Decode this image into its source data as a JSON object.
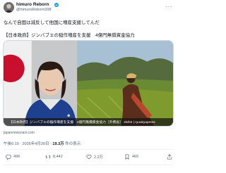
{
  "author": {
    "name": "himuro Reborn",
    "handle": "@himuroReborn398"
  },
  "post": {
    "text": "なんで自国は減反して他国に増産支援してんだ",
    "link_title": "【日本政府】ジンバブエの稲作増産を支援　4億円無償資金協力",
    "media_caption": "【日本政府】ジンバブエの稲作増産を支援　4億円無償資金協力［外務省］ 26/04 | ryuukyupress",
    "source_domain": "japannewsnavi.com",
    "time": "午後6:19 · 2026年4月30日",
    "views_count": "19.3万",
    "views_label": "件の表示"
  },
  "actions": {
    "replies": "496",
    "reposts": "8,442",
    "likes": "2.2万",
    "bookmarks": "465"
  },
  "colors": {
    "accent": "#1d9bf0",
    "muted": "#536471",
    "text": "#0f1419"
  }
}
